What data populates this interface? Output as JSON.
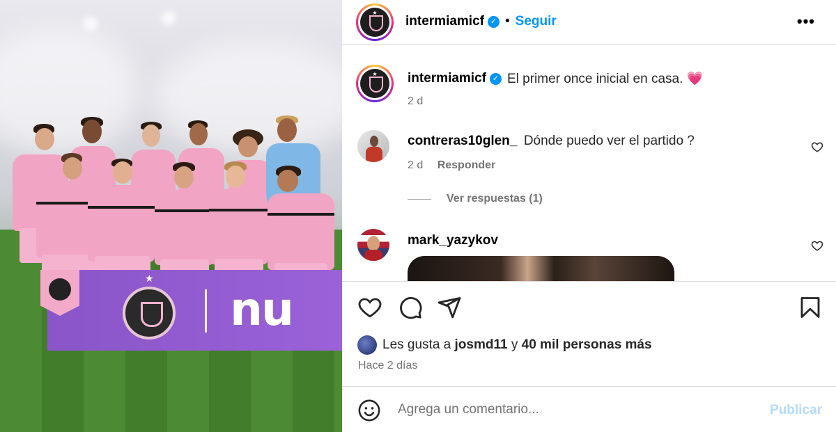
{
  "post": {
    "username": "intermiamicf",
    "dot": "•",
    "follow_label": "Seguir",
    "more_label": "•••",
    "caption_text": "El primer once inicial en casa. 💗",
    "caption_time": "2 d"
  },
  "comments": [
    {
      "username": "contreras10glen_",
      "text": "Dónde puedo ver el partido ?",
      "time": "2 d",
      "reply_label": "Responder",
      "view_replies_label": "Ver respuestas (1)"
    },
    {
      "username": "mark_yazykov",
      "text": ""
    }
  ],
  "likes": {
    "prefix": "Les gusta a",
    "user": "josmd11",
    "connector": "y",
    "rest": "40 mil personas más"
  },
  "posted_ago": "Hace 2 días",
  "composer": {
    "placeholder": "Agrega un comentario...",
    "publish_label": "Publicar"
  },
  "photo": {
    "banner_text": "nu",
    "colors": {
      "jersey": "#f2a4c4",
      "banner": "#8a55c9",
      "accent": "#0095f6"
    }
  },
  "icons": {
    "like": "heart-icon",
    "comment": "comment-icon",
    "share": "send-icon",
    "save": "bookmark-icon",
    "emoji": "emoji-icon"
  }
}
